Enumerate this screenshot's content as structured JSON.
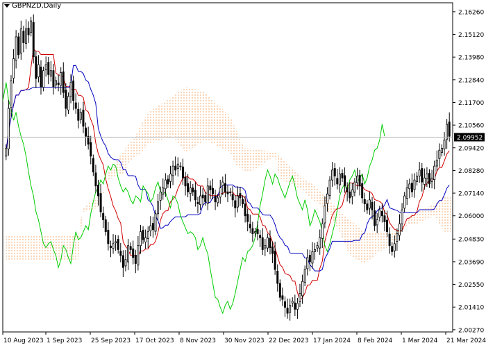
{
  "chart_data": {
    "type": "candlestick",
    "symbol_label": "GBPNZD,Daily",
    "current_price_label": "2.09952",
    "y_ticks": [
      "2.16260",
      "2.15120",
      "2.13980",
      "2.12840",
      "2.11700",
      "2.10560",
      "2.09420",
      "2.08280",
      "2.07140",
      "2.06000",
      "2.04830",
      "2.03690",
      "2.02550",
      "2.01410",
      "2.00270"
    ],
    "x_ticks": [
      "10 Aug 2023",
      "1 Sep 2023",
      "25 Sep 2023",
      "17 Oct 2023",
      "8 Nov 2023",
      "30 Nov 2023",
      "22 Dec 2023",
      "17 Jan 2024",
      "8 Feb 2024",
      "1 Mar 2024",
      "21 Mar 2024"
    ],
    "ylim": [
      2.0016,
      2.1671
    ],
    "colors": {
      "bull_candle": "#ffffff",
      "bear_candle": "#000000",
      "tenkan": "#d00000",
      "kijun": "#0000c0",
      "chikou": "#00cc00",
      "kumo_bull": "#f4a460",
      "kumo_bear": "#c8a8c8",
      "price_line": "#b0b0b0"
    },
    "closes": [
      2.094,
      2.114,
      2.128,
      2.139,
      2.15,
      2.141,
      2.154,
      2.147,
      2.154,
      2.151,
      2.158,
      2.14,
      2.129,
      2.136,
      2.125,
      2.133,
      2.136,
      2.131,
      2.133,
      2.125,
      2.128,
      2.126,
      2.132,
      2.122,
      2.114,
      2.12,
      2.127,
      2.118,
      2.114,
      2.108,
      2.112,
      2.105,
      2.1,
      2.096,
      2.09,
      2.082,
      2.075,
      2.07,
      2.062,
      2.058,
      2.052,
      2.046,
      2.044,
      2.046,
      2.047,
      2.043,
      2.04,
      2.034,
      2.038,
      2.045,
      2.043,
      2.039,
      2.036,
      2.045,
      2.052,
      2.048,
      2.049,
      2.052,
      2.055,
      2.053,
      2.061,
      2.067,
      2.072,
      2.074,
      2.078,
      2.076,
      2.081,
      2.085,
      2.083,
      2.086,
      2.085,
      2.079,
      2.075,
      2.072,
      2.074,
      2.072,
      2.068,
      2.066,
      2.07,
      2.069,
      2.067,
      2.075,
      2.073,
      2.071,
      2.067,
      2.069,
      2.074,
      2.077,
      2.072,
      2.071,
      2.072,
      2.068,
      2.064,
      2.07,
      2.069,
      2.066,
      2.06,
      2.057,
      2.054,
      2.051,
      2.052,
      2.051,
      2.049,
      2.043,
      2.045,
      2.049,
      2.044,
      2.041,
      2.033,
      2.026,
      2.019,
      2.018,
      2.014,
      2.011,
      2.015,
      2.017,
      2.013,
      2.016,
      2.021,
      2.027,
      2.033,
      2.039,
      2.037,
      2.042,
      2.043,
      2.045,
      2.049,
      2.056,
      2.065,
      2.071,
      2.078,
      2.083,
      2.08,
      2.076,
      2.081,
      2.079,
      2.075,
      2.072,
      2.069,
      2.073,
      2.077,
      2.08,
      2.075,
      2.069,
      2.066,
      2.063,
      2.068,
      2.063,
      2.055,
      2.058,
      2.063,
      2.06,
      2.057,
      2.052,
      2.045,
      2.042,
      2.046,
      2.051,
      2.056,
      2.063,
      2.07,
      2.074,
      2.076,
      2.072,
      2.078,
      2.08,
      2.083,
      2.077,
      2.079,
      2.081,
      2.076,
      2.079,
      2.085,
      2.088,
      2.093,
      2.094,
      2.098,
      2.106,
      2.1
    ],
    "kumo_spans": [
      {
        "x": [
          0,
          29,
          30,
          31,
          37,
          38,
          40,
          41,
          48,
          49,
          52,
          53,
          57,
          67,
          72,
          80,
          90,
          92,
          96,
          98,
          108,
          110,
          115,
          120,
          123,
          128,
          134,
          138,
          144,
          150,
          156,
          160,
          162,
          165,
          172,
          174,
          176,
          180,
          185,
          187
        ],
        "a": [
          2.05,
          2.05,
          2.058,
          2.064,
          2.064,
          2.07,
          2.072,
          2.082,
          2.082,
          2.086,
          2.09,
          2.103,
          2.112,
          2.12,
          2.125,
          2.122,
          2.11,
          2.104,
          2.094,
          2.094,
          2.092,
          2.078,
          2.076,
          2.072,
          2.068,
          2.064,
          2.052,
          2.04,
          2.036,
          2.042,
          2.046,
          2.054,
          2.06,
          2.062,
          2.066,
          2.068,
          2.07,
          2.07,
          2.068,
          2.068
        ],
        "b": [
          2.038,
          2.038,
          2.052,
          2.062,
          2.07,
          2.072,
          2.072,
          2.078,
          2.094,
          2.096,
          2.1,
          2.09,
          2.096,
          2.1,
          2.092,
          2.098,
          2.092,
          2.086,
          2.082,
          2.082,
          2.09,
          2.09,
          2.084,
          2.078,
          2.076,
          2.07,
          2.062,
          2.058,
          2.052,
          2.052,
          2.052,
          2.054,
          2.056,
          2.056,
          2.06,
          2.056,
          2.052,
          2.052,
          2.052,
          2.052
        ]
      }
    ]
  }
}
